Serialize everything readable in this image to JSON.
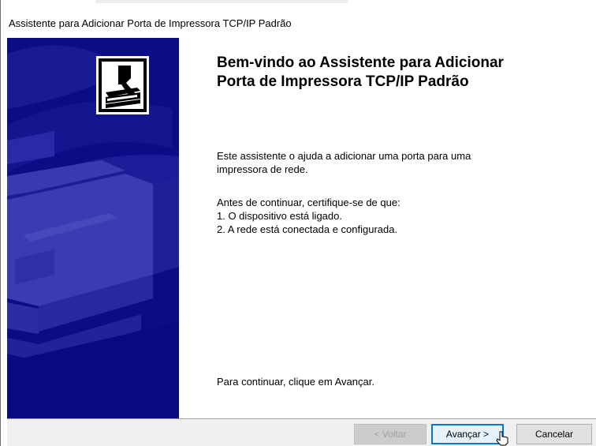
{
  "window": {
    "title": "Assistente para Adicionar Porta de Impressora TCP/IP Padrão"
  },
  "content": {
    "heading_line1": "Bem-vindo ao Assistente para Adicionar",
    "heading_line2": "Porta de Impressora TCP/IP Padrão",
    "intro_line1": "Este assistente o ajuda a adicionar uma porta para uma",
    "intro_line2": "impressora de rede.",
    "prereq_title": "Antes de continuar, certifique-se de que:",
    "prereq_1": "1. O dispositivo está ligado.",
    "prereq_2": "2. A rede está conectada e configurada.",
    "continue_hint": "Para continuar, clique em Avançar."
  },
  "buttons": {
    "back_label": "< Voltar",
    "next_label": "Avançar >",
    "cancel_label": "Cancelar"
  },
  "colors": {
    "banner": "#0c0c86",
    "accent": "#0078d7"
  },
  "icons": {
    "banner_icon": "printer-icon",
    "cursor": "mouse-pointer-icon"
  }
}
